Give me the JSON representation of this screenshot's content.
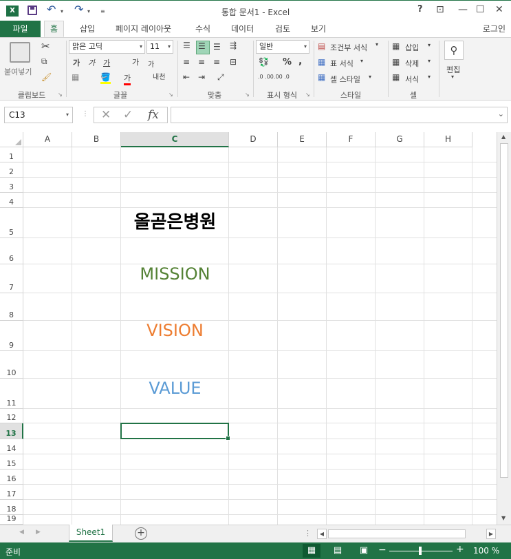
{
  "titlebar": {
    "app_icon": "X",
    "title": "통합 문서1 - Excel",
    "help": "?",
    "controls": {
      "restore_ribbon": "⊡",
      "minimize": "—",
      "maximize": "☐",
      "close": "✕"
    }
  },
  "tabs": {
    "file": "파일",
    "items": [
      "홈",
      "삽입",
      "페이지 레이아웃",
      "수식",
      "데이터",
      "검토",
      "보기"
    ],
    "active": "홈",
    "login": "로그인"
  },
  "ribbon": {
    "clipboard": {
      "paste": "붙여넣기",
      "label": "클립보드"
    },
    "font": {
      "name": "맑은 고딕",
      "size": "11",
      "bold": "가",
      "italic": "가",
      "underline": "가",
      "grow": "가",
      "shrink": "가",
      "color_a": "가",
      "phonetic": "내천",
      "label": "글꼴"
    },
    "alignment": {
      "label": "맞춤"
    },
    "number": {
      "format": "일반",
      "percent": "%",
      "comma": ",",
      "label": "표시 형식",
      "inc": ".0 .00",
      "dec": ".00 .0"
    },
    "styles": {
      "conditional": "조건부 서식",
      "table": "표 서식",
      "cell": "셀 스타일",
      "label": "스타일"
    },
    "cells": {
      "insert": "삽입",
      "delete": "삭제",
      "format": "서식",
      "label": "셀"
    },
    "editing": {
      "label": "편집"
    }
  },
  "formula_bar": {
    "name_box": "C13",
    "cancel": "✕",
    "enter": "✓",
    "fx": "fx",
    "value": ""
  },
  "sheet": {
    "columns": [
      "A",
      "B",
      "C",
      "D",
      "E",
      "F",
      "G",
      "H"
    ],
    "selected_column": "C",
    "rows": [
      "1",
      "2",
      "3",
      "4",
      "5",
      "6",
      "7",
      "8",
      "9",
      "10",
      "11",
      "12",
      "13",
      "14",
      "15",
      "16",
      "17",
      "18",
      "19"
    ],
    "selected_row": "13",
    "cells": {
      "C5": {
        "text": "올곧은병원",
        "color": "#000000"
      },
      "C7": {
        "text": "MISSION",
        "color": "#548235"
      },
      "C9": {
        "text": "VISION",
        "color": "#ed7d31"
      },
      "C11": {
        "text": "VALUE",
        "color": "#5b9bd5"
      }
    }
  },
  "sheet_tabs": {
    "tabs": [
      "Sheet1"
    ],
    "active": "Sheet1",
    "add": "+"
  },
  "status": {
    "text": "준비",
    "zoom": "100 %",
    "zoom_minus": "−",
    "zoom_plus": "+"
  },
  "colors": {
    "accent": "#217346"
  }
}
